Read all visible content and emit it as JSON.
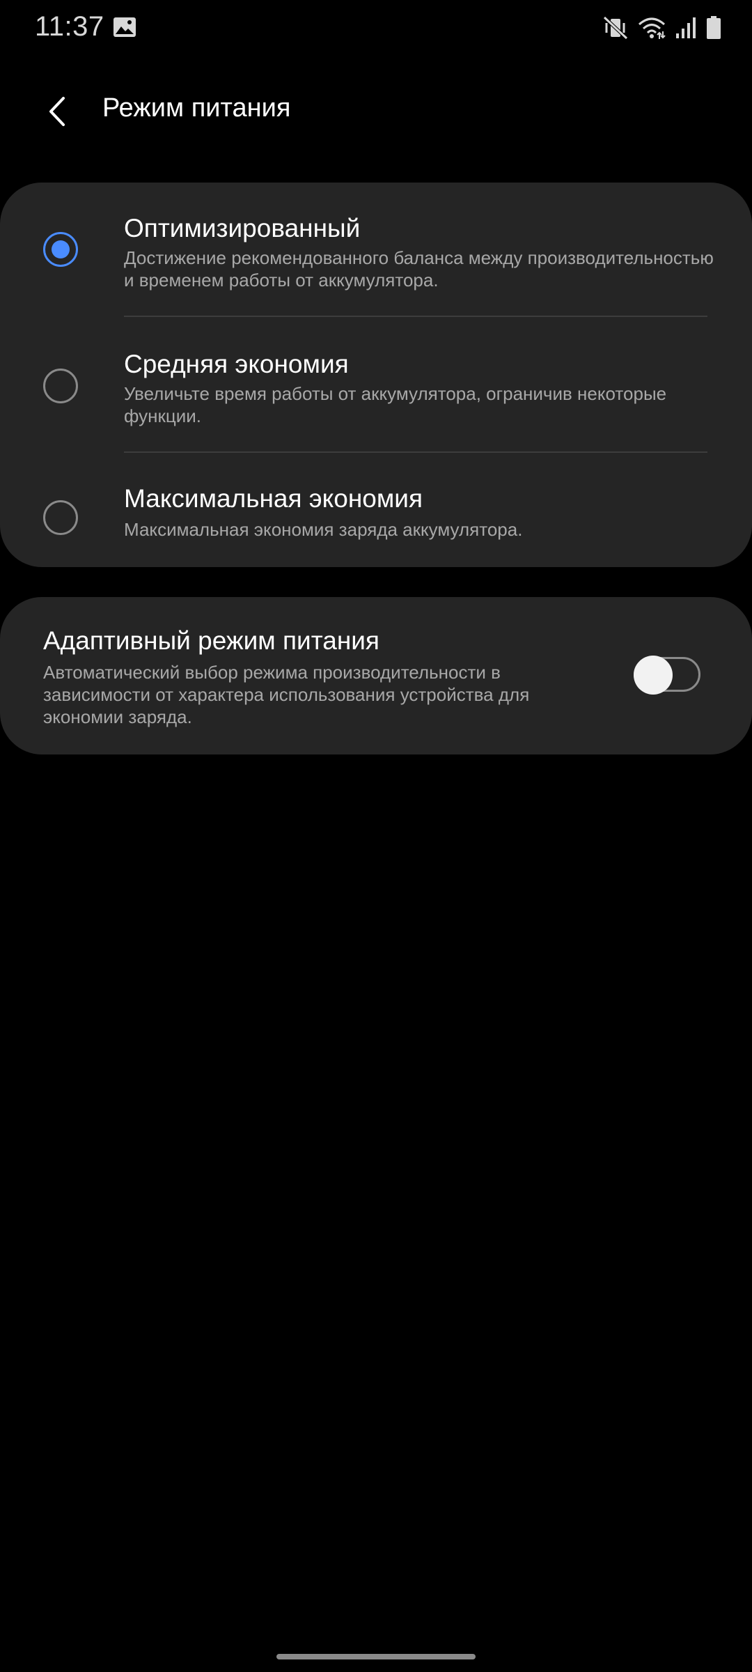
{
  "status_bar": {
    "time": "11:37",
    "left_icons": [
      "gallery-icon"
    ],
    "right_icons": [
      "vibrate-mute-icon",
      "wifi-icon",
      "signal-icon",
      "battery-icon"
    ]
  },
  "header": {
    "back_icon": "back-arrow-icon",
    "title": "Режим питания"
  },
  "power_modes": {
    "selected_index": 0,
    "accent_color": "#4a8cff",
    "items": [
      {
        "title": "Оптимизированный",
        "description": "Достижение рекомендованного баланса между производительностью и временем работы от аккумулятора.",
        "checked": true
      },
      {
        "title": "Средняя экономия",
        "description": "Увеличьте время работы от аккумулятора, ограничив некоторые функции.",
        "checked": false
      },
      {
        "title": "Максимальная экономия",
        "description": "Максимальная экономия заряда аккумулятора.",
        "checked": false
      }
    ]
  },
  "adaptive_mode": {
    "title": "Адаптивный режим питания",
    "description": "Автоматический выбор режима производительности в зависимости от характера использования устройства для экономии заряда.",
    "enabled": false
  },
  "colors": {
    "background": "#000000",
    "card": "#252525",
    "secondary_text": "#a8a8a8"
  }
}
